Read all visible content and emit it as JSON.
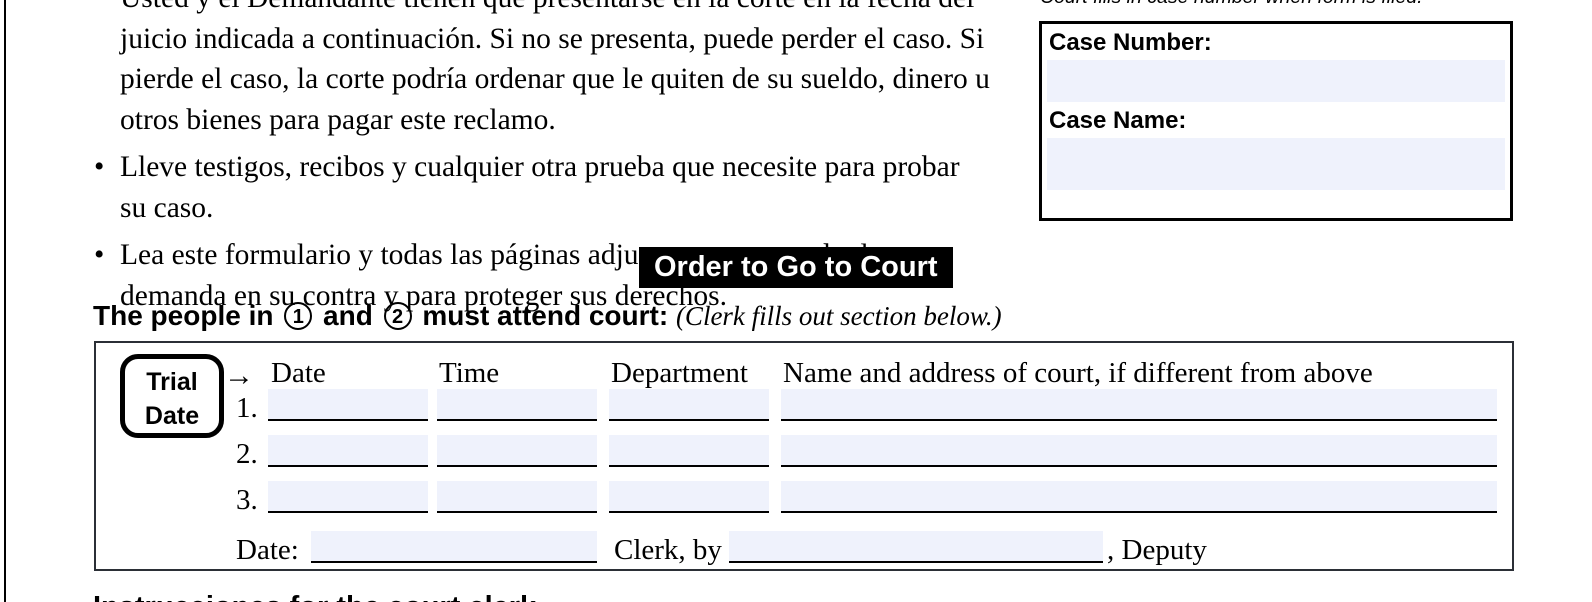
{
  "notice": {
    "paragraph_lines": [
      "Usted y el Demandante tienen que presentarse en la corte en la fecha del",
      "juicio indicada a continuación. Si no se presenta, puede perder el caso. Si",
      "pierde el caso, la corte podría ordenar que le quiten de su sueldo, dinero u",
      "otros bienes para pagar este reclamo."
    ],
    "bullets": [
      "Lleve testigos, recibos y cualquier otra prueba que necesite para probar su caso.",
      "Lea este formulario y todas las páginas adjuntas para entender la demanda en su contra y para proteger sus derechos."
    ],
    "bullet_marker": "•"
  },
  "case_box": {
    "caption": "Court fills in case number when form is filed.",
    "case_number_label": "Case Number:",
    "case_number_value": "",
    "case_name_label": "Case Name:",
    "case_name_value": ""
  },
  "order_section": {
    "banner": "Order to Go to Court",
    "attend_prefix": "The people in",
    "circle_one": "1",
    "attend_mid": "and",
    "circle_two": "2",
    "attend_suffix": "must attend court:",
    "clerk_note": "(Clerk fills out section below.)"
  },
  "trial_table": {
    "badge_line1": "Trial",
    "badge_line2": "Date",
    "arrow": "→",
    "columns": [
      "Date",
      "Time",
      "Department",
      "Name and address of court, if different from above"
    ],
    "rows": [
      {
        "num": "1.",
        "date": "",
        "time": "",
        "department": "",
        "court": ""
      },
      {
        "num": "2.",
        "date": "",
        "time": "",
        "department": "",
        "court": ""
      },
      {
        "num": "3.",
        "date": "",
        "time": "",
        "department": "",
        "court": ""
      }
    ],
    "footer": {
      "date_label": "Date:",
      "date_value": "",
      "clerk_label": "Clerk, by",
      "clerk_value": "",
      "deputy_label": ", Deputy"
    }
  },
  "bottom_clipped_heading": "Instrucciones for the court clerk",
  "colors": {
    "field_fill": "#eff2fc",
    "rule": "#000000",
    "table_border": "#2b2f36",
    "banner_bg": "#000000",
    "banner_text": "#ffffff"
  }
}
